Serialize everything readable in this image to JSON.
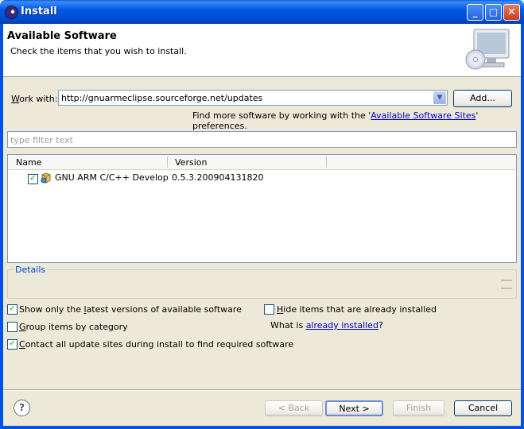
{
  "window": {
    "title": "Install"
  },
  "header": {
    "title": "Available Software",
    "description": "Check the items that you wish to install."
  },
  "work_with": {
    "label_pre": "",
    "label_ul": "W",
    "label_post": "ork with:",
    "value": "http://gnuarmeclipse.sourceforge.net/updates",
    "add_button": "Add...",
    "find_more_pre": "Find more software by working with the '",
    "find_more_link": "Available Software Sites",
    "find_more_post": "' preferences."
  },
  "filter": {
    "placeholder": "type filter text"
  },
  "table": {
    "columns": [
      "Name",
      "Version"
    ],
    "rows": [
      {
        "checked": true,
        "name": "GNU ARM C/C++ Development Support",
        "version": "0.5.3.200904131820"
      }
    ]
  },
  "details": {
    "label": "Details"
  },
  "options": {
    "latest": {
      "checked": true,
      "pre": "Show only the ",
      "ul": "l",
      "post": "atest versions of available software"
    },
    "group": {
      "checked": false,
      "pre": "",
      "ul": "G",
      "post": "roup items by category"
    },
    "contact": {
      "checked": true,
      "pre": "",
      "ul": "C",
      "post": "ontact all update sites during install to find required software"
    },
    "hide": {
      "checked": false,
      "pre": "",
      "ul": "H",
      "post": "ide items that are already installed"
    },
    "what_is_pre": "What is ",
    "what_is_link": "already installed",
    "what_is_post": "?"
  },
  "buttons": {
    "back": "< Back",
    "next": "Next >",
    "finish": "Finish",
    "cancel": "Cancel"
  },
  "icons": {
    "title": "eclipse-icon",
    "header": "monitor-cd-icon",
    "row": "feature-plugin-icon",
    "help": "help-icon"
  }
}
